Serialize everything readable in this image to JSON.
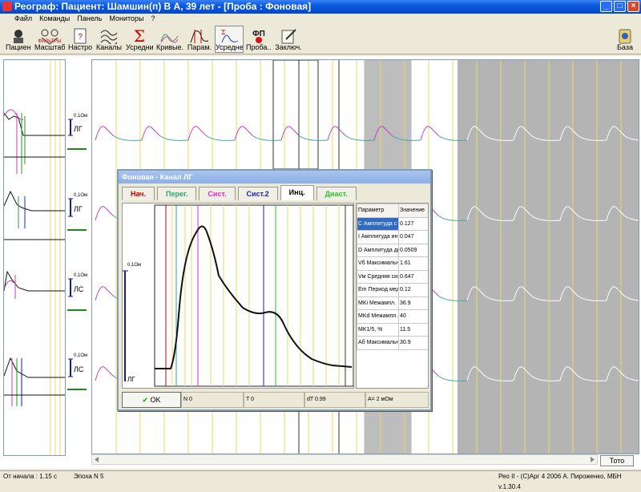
{
  "window": {
    "title": "Реограф: Пациент: Шамшин(п) В А, 39 лет - [Проба : Фоновая]",
    "controls": [
      "_",
      "□",
      "×"
    ]
  },
  "menu": [
    "Файл",
    "Команды",
    "Панель",
    "Мониторы",
    "?"
  ],
  "toolbar": [
    {
      "label": "Пациент",
      "icon": "patient-icon"
    },
    {
      "label": "Масштаб",
      "icon": "scale-icon",
      "badge": "ФИЛЬТРЫ"
    },
    {
      "label": "Настрой...",
      "icon": "settings-icon"
    },
    {
      "label": "Каналы",
      "icon": "channels-icon"
    },
    {
      "label": "Усредни...",
      "icon": "sigma-icon"
    },
    {
      "label": "Кривые...",
      "icon": "curves-icon"
    },
    {
      "label": "Парам.",
      "icon": "params-icon"
    },
    {
      "label": "Усреднен.",
      "icon": "averaged-icon"
    },
    {
      "label": "Проба...",
      "icon": "probe-icon",
      "badge": "ФП"
    },
    {
      "label": "Заключ.",
      "icon": "conclusion-icon"
    },
    {
      "label": "База",
      "icon": "database-icon"
    }
  ],
  "channels": [
    {
      "name": "ЛГ",
      "scale": "0,1Ом"
    },
    {
      "name": "ЛГ",
      "scale": "0,1Ом"
    },
    {
      "name": "ЛС",
      "scale": "0,1Ом"
    },
    {
      "name": "ЛС",
      "scale": "0,1Ом"
    }
  ],
  "dialog": {
    "title": "Фоновая - Канал ЛГ",
    "tabs": [
      {
        "label": "Нач.",
        "color": "#c00000"
      },
      {
        "label": "Перег.",
        "color": "#2aa876"
      },
      {
        "label": "Сист.",
        "color": "#e02ad0"
      },
      {
        "label": "Сист.2",
        "color": "#1f1fa0"
      },
      {
        "label": "Инц.",
        "color": "#000000",
        "active": true
      },
      {
        "label": "Диаст.",
        "color": "#2ec02e"
      }
    ],
    "plot_scale": "0,1Ом",
    "plot_channel": "ЛГ",
    "table": {
      "headers": [
        "Параметр",
        "Значение"
      ],
      "rows": [
        [
          "C  Амплитуда с",
          "0.127"
        ],
        [
          "I  Амплитуда ин",
          "0.047"
        ],
        [
          "D  Амплитуда ди",
          "0.0509"
        ],
        [
          "Vб  Максимальн",
          "1.61"
        ],
        [
          "Vм  Средняя ско",
          "0.647"
        ],
        [
          "Em  Период мед",
          "0.12"
        ],
        [
          "MKi  Межампл.",
          "36.9"
        ],
        [
          "MKd  Межампл.",
          "40"
        ],
        [
          "MK1/5, %",
          "11.5"
        ],
        [
          "Aб  Максимальн",
          "30.9"
        ]
      ]
    },
    "ok_label": "OK",
    "status": [
      "N 0",
      "T 0",
      "dT 0.99",
      "A= 2 мОм"
    ]
  },
  "totobtn": "Тото",
  "statusbar": {
    "left": "От начала : 1.15 с",
    "epoch": "Эпоха N 5",
    "right": "Рео II - (C)Арг  4 2006 А. Пироженко, МБН v.1.30.4"
  },
  "colors": {
    "rise": "#c040c0",
    "fall": "#40a8a0",
    "grey_zone": "#b4b4b4",
    "marker_yellow": "#e8d870"
  }
}
